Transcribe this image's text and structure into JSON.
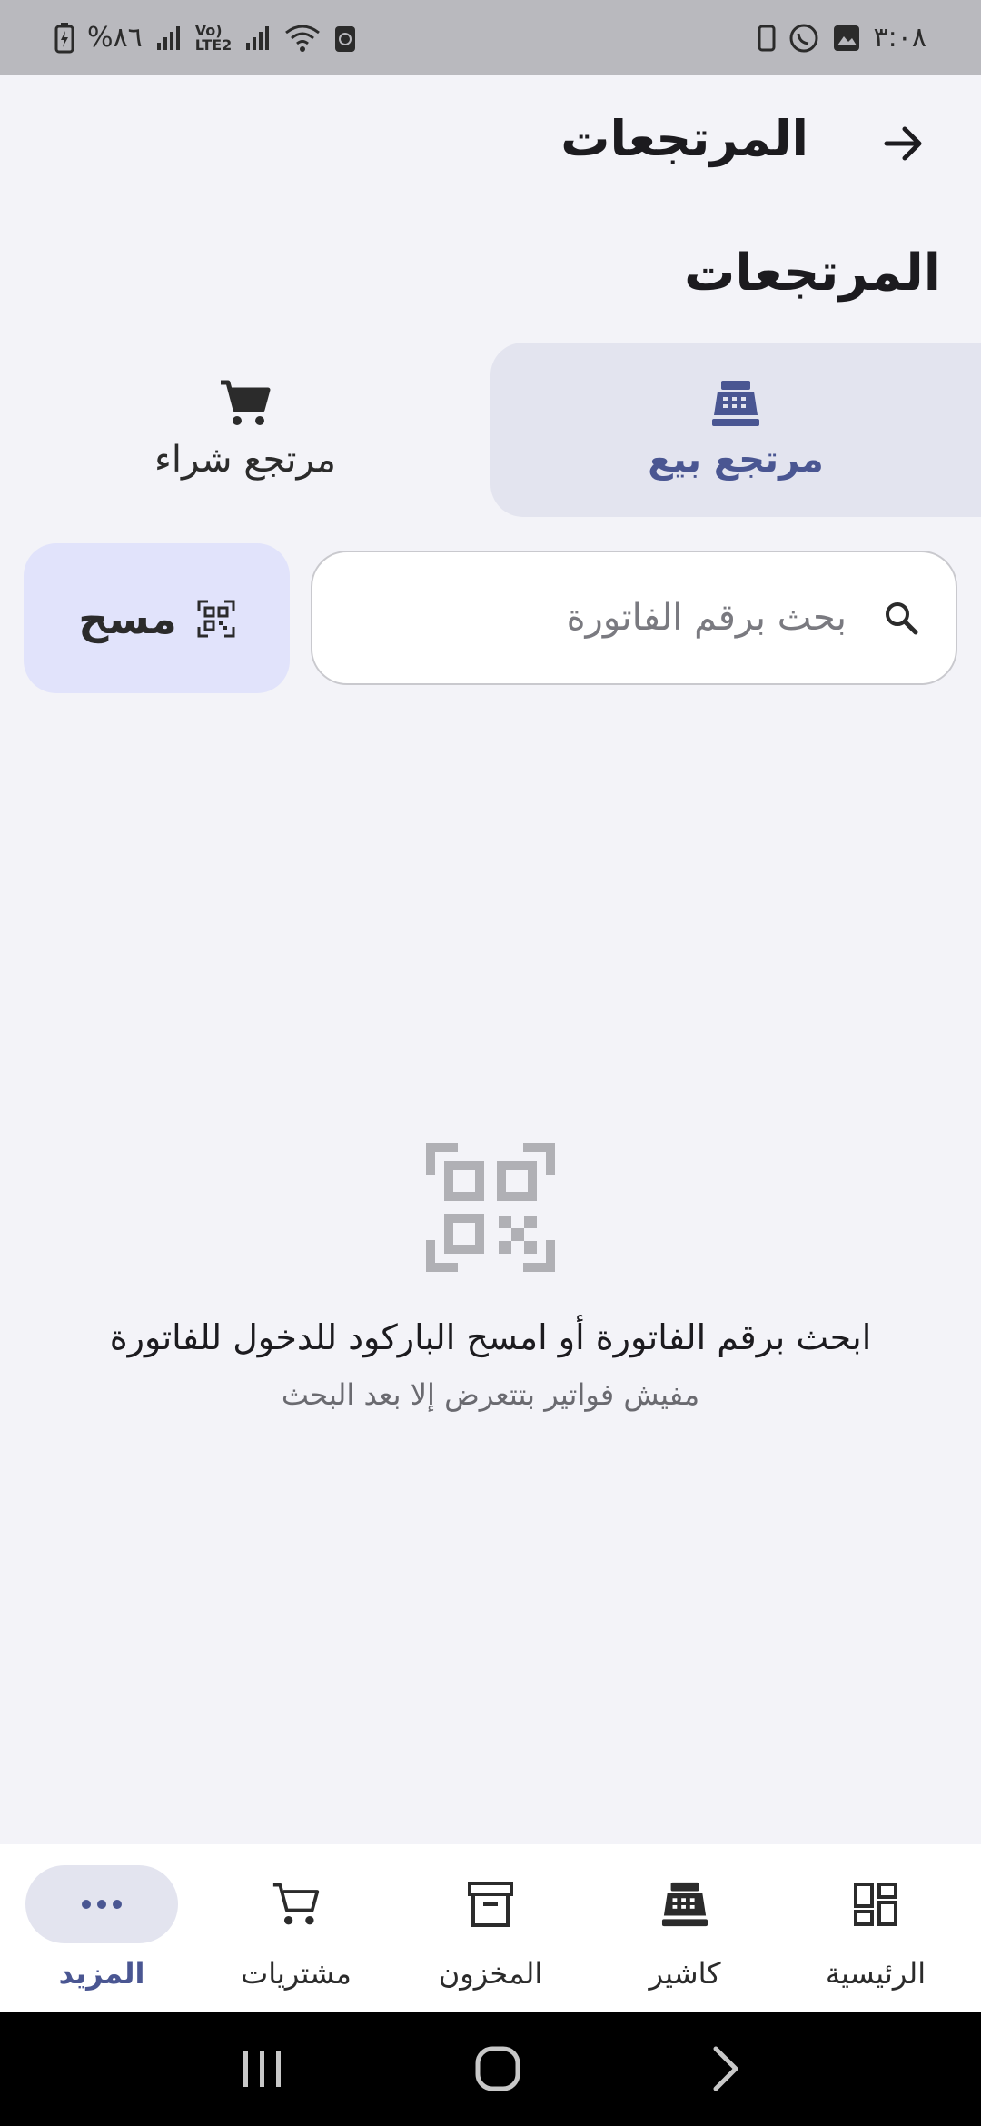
{
  "status_bar": {
    "time": "٣:٠٨",
    "battery": "%٨٦",
    "network_label": "Vo) LTE2"
  },
  "app_bar": {
    "title": "المرتجعات"
  },
  "section": {
    "title": "المرتجعات"
  },
  "tabs": [
    {
      "label": "مرتجع بيع",
      "icon": "cash-register-icon",
      "selected": true
    },
    {
      "label": "مرتجع شراء",
      "icon": "cart-icon",
      "selected": false
    }
  ],
  "search": {
    "placeholder": "بحث برقم الفاتورة",
    "value": ""
  },
  "scan_button": {
    "label": "مسح",
    "icon": "qr-scan-icon"
  },
  "empty_state": {
    "icon": "qr-code-icon",
    "title": "ابحث برقم الفاتورة أو امسح الباركود للدخول للفاتورة",
    "subtitle": "مفيش فواتير بتتعرض إلا بعد البحث"
  },
  "bottom_nav": [
    {
      "label": "الرئيسية",
      "icon": "dashboard-icon",
      "active": false
    },
    {
      "label": "كاشير",
      "icon": "cash-register-icon",
      "active": false
    },
    {
      "label": "المخزون",
      "icon": "archive-box-icon",
      "active": false
    },
    {
      "label": "مشتريات",
      "icon": "cart-icon",
      "active": false
    },
    {
      "label": "المزيد",
      "icon": "more-dots-icon",
      "active": true
    }
  ],
  "colors": {
    "accent": "#4a5692",
    "selected_tab_bg": "#e3e4ef",
    "scan_button_bg": "#e1e3fb",
    "page_bg": "#f3f3f8"
  }
}
